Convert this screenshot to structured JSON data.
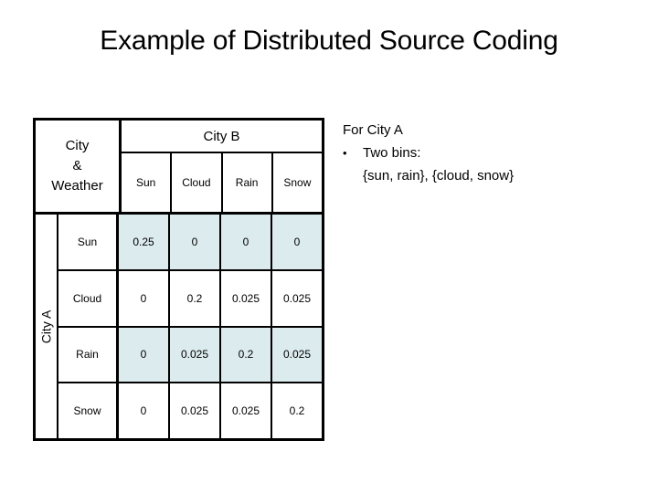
{
  "slide": {
    "title": "Example of Distributed Source Coding"
  },
  "table": {
    "corner_label_lines": [
      "City",
      "&",
      "Weather"
    ],
    "column_group_header": "City B",
    "row_group_header": "City A",
    "columns": [
      "Sun",
      "Cloud",
      "Rain",
      "Snow"
    ],
    "rows": [
      "Sun",
      "Cloud",
      "Rain",
      "Snow"
    ],
    "values": [
      [
        "0.25",
        "0",
        "0",
        "0"
      ],
      [
        "0",
        "0.2",
        "0.025",
        "0.025"
      ],
      [
        "0",
        "0.025",
        "0.2",
        "0.025"
      ],
      [
        "0",
        "0.025",
        "0.025",
        "0.2"
      ]
    ],
    "tinted_rows": [
      0,
      2
    ],
    "tint_color": "#dcebee",
    "border_color": "#000000"
  },
  "notes": {
    "lead": "For City A",
    "bullet_glyph": "•",
    "bullet_text": "Two bins:",
    "sub_text": "{sun, rain}, {cloud, snow}"
  },
  "chart_data": {
    "type": "table",
    "title": "Example of Distributed Source Coding",
    "xlabel": "City B",
    "ylabel": "City A",
    "categories": [
      "Sun",
      "Cloud",
      "Rain",
      "Snow"
    ],
    "rows": [
      "Sun",
      "Cloud",
      "Rain",
      "Snow"
    ],
    "series": [
      {
        "name": "Sun",
        "values": [
          0.25,
          0,
          0,
          0
        ]
      },
      {
        "name": "Cloud",
        "values": [
          0,
          0.2,
          0.025,
          0.025
        ]
      },
      {
        "name": "Rain",
        "values": [
          0,
          0.025,
          0.2,
          0.025
        ]
      },
      {
        "name": "Snow",
        "values": [
          0,
          0.025,
          0.025,
          0.2
        ]
      }
    ]
  }
}
